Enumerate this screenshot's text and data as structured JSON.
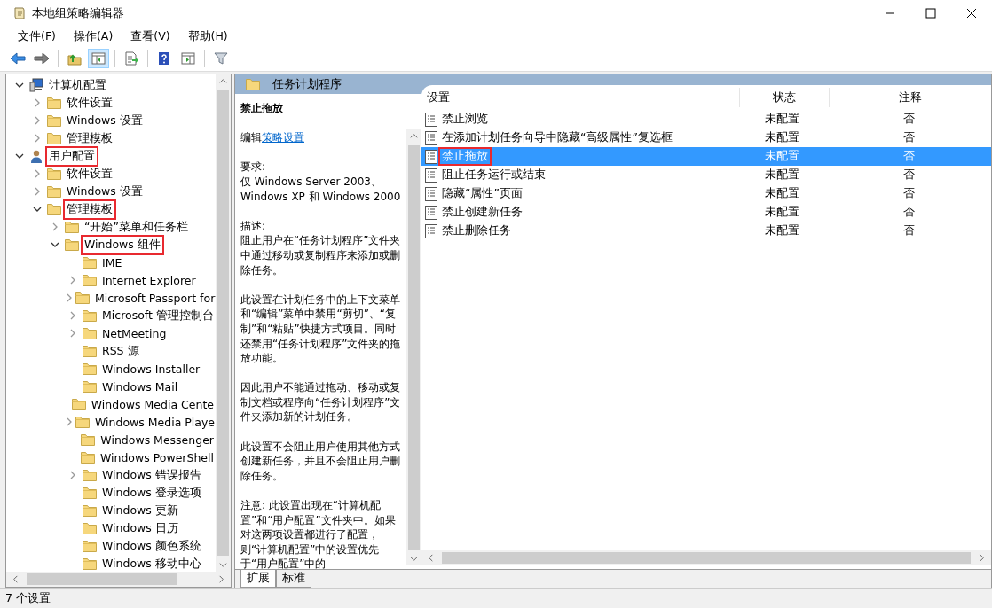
{
  "window": {
    "title": "本地组策略编辑器"
  },
  "menu": [
    "文件(F)",
    "操作(A)",
    "查看(V)",
    "帮助(H)"
  ],
  "toolbar": [
    [
      {
        "kind": "back",
        "active": false
      },
      {
        "kind": "forward",
        "active": false
      }
    ],
    [
      {
        "kind": "up",
        "active": false
      },
      {
        "kind": "tree",
        "active": true
      }
    ],
    [
      {
        "kind": "export",
        "active": false
      }
    ],
    [
      {
        "kind": "help",
        "active": false
      },
      {
        "kind": "pane",
        "active": false
      }
    ],
    [
      {
        "kind": "filter",
        "active": false
      }
    ]
  ],
  "tree": [
    {
      "label": "计算机配置",
      "kind": "computer",
      "expanded": true,
      "marked": false,
      "children": [
        {
          "label": "软件设置",
          "kind": "folder",
          "expanded": false,
          "marked": false
        },
        {
          "label": "Windows 设置",
          "kind": "folder",
          "expanded": false,
          "marked": false
        },
        {
          "label": "管理模板",
          "kind": "folder",
          "expanded": false,
          "marked": false
        }
      ]
    },
    {
      "label": "用户配置",
      "kind": "user",
      "expanded": true,
      "marked": true,
      "children": [
        {
          "label": "软件设置",
          "kind": "folder",
          "expanded": false,
          "marked": false
        },
        {
          "label": "Windows 设置",
          "kind": "folder",
          "expanded": false,
          "marked": false
        },
        {
          "label": "管理模板",
          "kind": "folder",
          "expanded": true,
          "marked": true,
          "children": [
            {
              "label": "“开始”菜单和任务栏",
              "kind": "folder",
              "expanded": false,
              "marked": false
            },
            {
              "label": "Windows 组件",
              "kind": "folder",
              "expanded": true,
              "marked": true,
              "children": [
                {
                  "label": "IME",
                  "kind": "folder",
                  "marked": false
                },
                {
                  "label": "Internet Explorer",
                  "kind": "folder",
                  "expanded": false,
                  "marked": false
                },
                {
                  "label": "Microsoft Passport for",
                  "kind": "folder",
                  "expanded": false,
                  "marked": false
                },
                {
                  "label": "Microsoft 管理控制台",
                  "kind": "folder",
                  "expanded": false,
                  "marked": false
                },
                {
                  "label": "NetMeeting",
                  "kind": "folder",
                  "expanded": false,
                  "marked": false
                },
                {
                  "label": "RSS 源",
                  "kind": "folder",
                  "marked": false
                },
                {
                  "label": "Windows Installer",
                  "kind": "folder",
                  "marked": false
                },
                {
                  "label": "Windows Mail",
                  "kind": "folder",
                  "marked": false
                },
                {
                  "label": "Windows Media Cente",
                  "kind": "folder",
                  "marked": false
                },
                {
                  "label": "Windows Media Playe",
                  "kind": "folder",
                  "expanded": false,
                  "marked": false
                },
                {
                  "label": "Windows Messenger",
                  "kind": "folder",
                  "marked": false
                },
                {
                  "label": "Windows PowerShell",
                  "kind": "folder",
                  "marked": false
                },
                {
                  "label": "Windows 错误报告",
                  "kind": "folder",
                  "expanded": false,
                  "marked": false
                },
                {
                  "label": "Windows 登录选项",
                  "kind": "folder",
                  "marked": false
                },
                {
                  "label": "Windows 更新",
                  "kind": "folder",
                  "marked": false
                },
                {
                  "label": "Windows 日历",
                  "kind": "folder",
                  "marked": false
                },
                {
                  "label": "Windows 颜色系统",
                  "kind": "folder",
                  "marked": false
                },
                {
                  "label": "Windows 移动中心",
                  "kind": "folder",
                  "marked": false
                }
              ]
            }
          ]
        }
      ]
    }
  ],
  "pane_title": "任务计划程序",
  "details": {
    "title": "禁止拖放",
    "edit_prefix": "编辑",
    "edit_link": "策略设置",
    "requirements": {
      "label": "要求:",
      "text": "仅 Windows Server 2003、Windows XP 和 Windows 2000"
    },
    "description": {
      "label": "描述:",
      "paragraphs": [
        "阻止用户在“任务计划程序”文件夹中通过移动或复制程序来添加或删除任务。",
        "此设置在计划任务中的上下文菜单和“编辑”菜单中禁用“剪切”、“复制”和“粘贴”快捷方式项目。同时还禁用“任务计划程序”文件夹的拖放功能。",
        "因此用户不能通过拖动、移动或复制文档或程序向“任务计划程序”文件夹添加新的计划任务。",
        "此设置不会阻止用户使用其他方式创建新任务，并且不会阻止用户删除任务。",
        "注意: 此设置出现在“计算机配置”和“用户配置”文件夹中。如果对这两项设置都进行了配置，则“计算机配置”中的设置优先于“用户配置”中的"
      ]
    }
  },
  "table": {
    "columns": [
      "设置",
      "状态",
      "注释"
    ],
    "rows": [
      {
        "name": "禁止浏览",
        "state": "未配置",
        "comment": "否",
        "selected": false,
        "marked": false
      },
      {
        "name": "在添加计划任务向导中隐藏“高级属性”复选框",
        "state": "未配置",
        "comment": "否",
        "selected": false,
        "marked": false
      },
      {
        "name": "禁止拖放",
        "state": "未配置",
        "comment": "否",
        "selected": true,
        "marked": true
      },
      {
        "name": "阻止任务运行或结束",
        "state": "未配置",
        "comment": "否",
        "selected": false,
        "marked": false
      },
      {
        "name": "隐藏“属性”页面",
        "state": "未配置",
        "comment": "否",
        "selected": false,
        "marked": false
      },
      {
        "name": "禁止创建新任务",
        "state": "未配置",
        "comment": "否",
        "selected": false,
        "marked": false
      },
      {
        "name": "禁止删除任务",
        "state": "未配置",
        "comment": "否",
        "selected": false,
        "marked": false
      }
    ]
  },
  "view_tabs": [
    {
      "label": "扩展",
      "selected": true
    },
    {
      "label": "标准",
      "selected": false
    }
  ],
  "status_bar": "7 个设置"
}
